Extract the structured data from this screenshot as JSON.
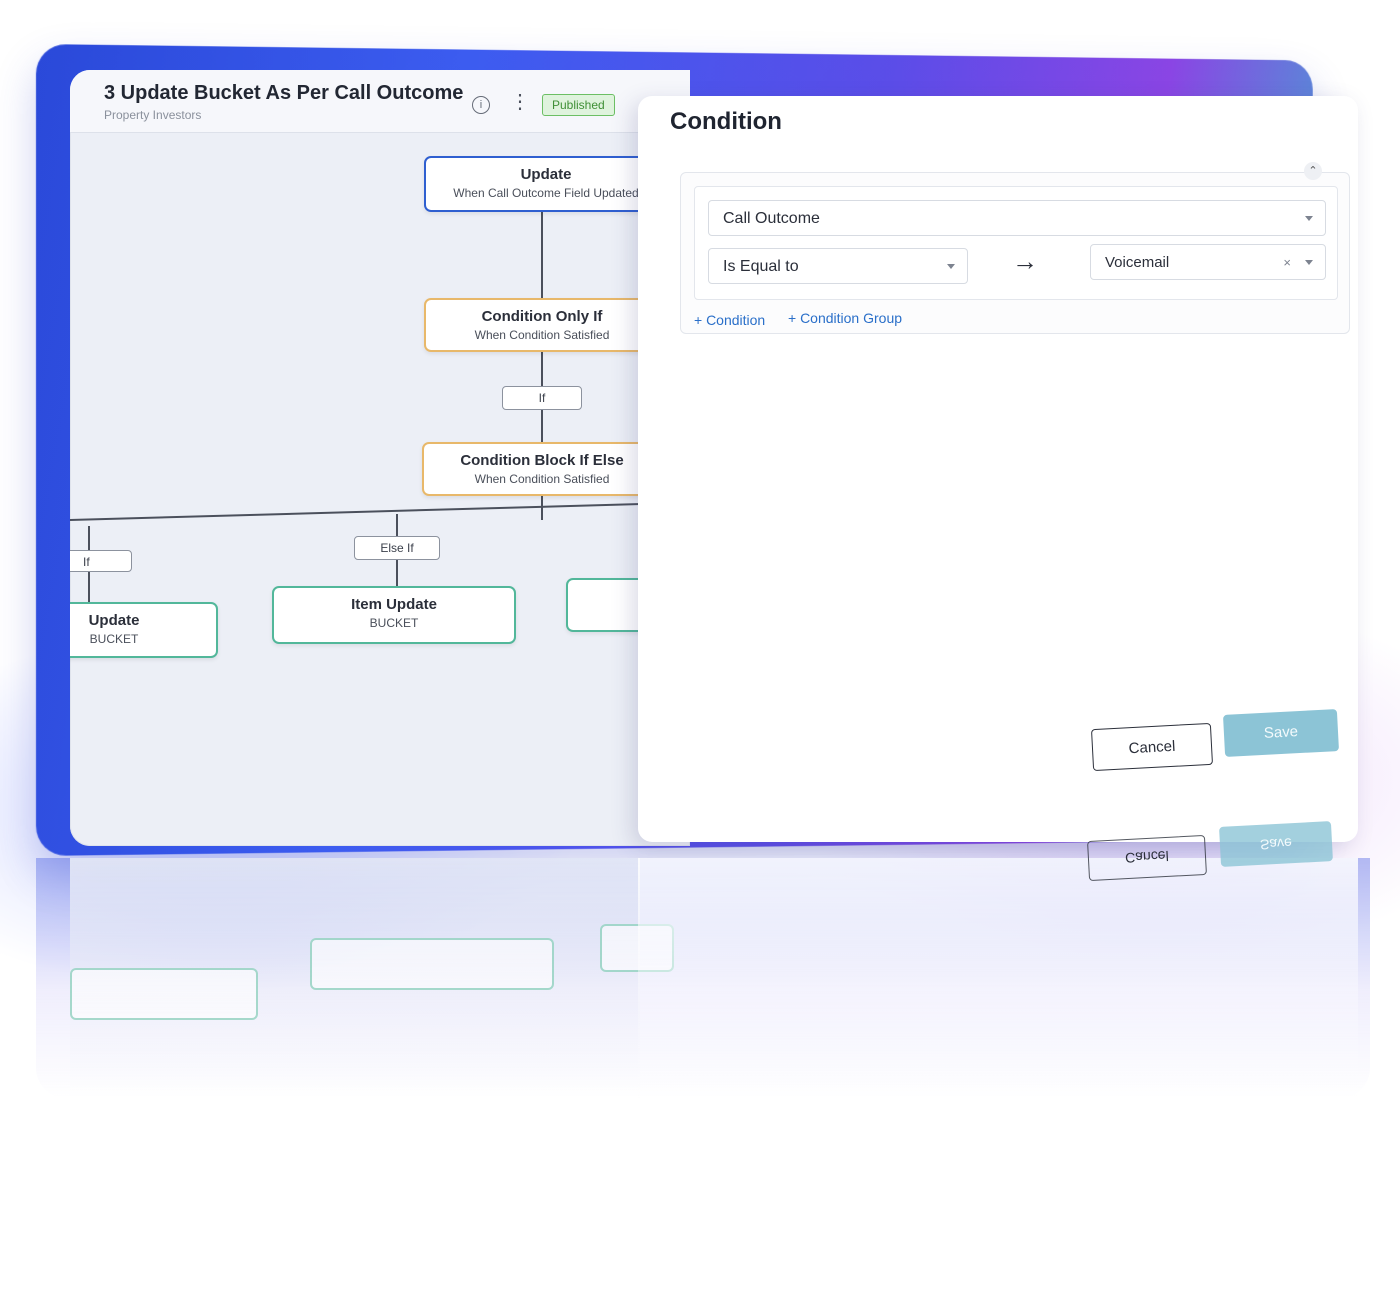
{
  "workflow": {
    "title": "3 Update Bucket As Per Call Outcome",
    "subtitle": "Property Investors",
    "status": "Published",
    "info_icon": "info-icon",
    "menu_icon": "more-vertical-icon"
  },
  "flow": {
    "trigger": {
      "title": "Update",
      "subtitle": "When Call Outcome Field Updated"
    },
    "condition_only_if": {
      "title": "Condition Only If",
      "subtitle": "When Condition Satisfied"
    },
    "if_label": "If",
    "condition_block": {
      "title": "Condition Block If Else",
      "subtitle": "When Condition Satisfied"
    },
    "branch_if_label": "If",
    "branch_elseif_label": "Else If",
    "left_node": {
      "title": "Update",
      "subtitle": "BUCKET"
    },
    "middle_node": {
      "title": "Item Update",
      "subtitle": "BUCKET"
    }
  },
  "condition_panel": {
    "title": "Condition",
    "field": "Call Outcome",
    "operator": "Is Equal to",
    "value": "Voicemail",
    "add_condition": "+ Condition",
    "add_condition_group": "+ Condition Group",
    "cancel_label": "Cancel",
    "save_label": "Save"
  },
  "colors": {
    "accent_blue": "#2a6fc9",
    "published_green": "#3f8f36",
    "save_disabled": "#8cc4d6"
  }
}
